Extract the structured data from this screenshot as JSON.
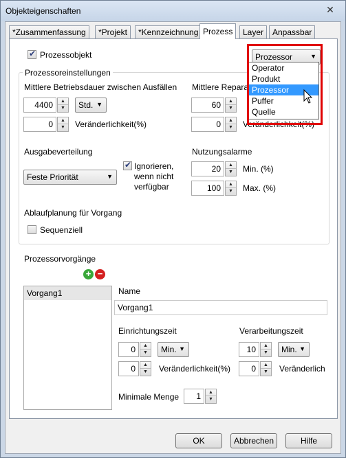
{
  "window": {
    "title": "Objekteigenschaften"
  },
  "icons": {
    "close": "✕",
    "chevron": "▼",
    "up": "▲",
    "down": "▼",
    "add": "+",
    "remove": "−"
  },
  "colors": {
    "add_icon": "#3aa83a",
    "remove_icon": "#d42020",
    "highlight": "#e00000",
    "selection": "#3399ff"
  },
  "tabs": [
    {
      "label": "*Zusammenfassung"
    },
    {
      "label": "*Projekt"
    },
    {
      "label": "*Kennzeichnung"
    },
    {
      "label": "Prozess"
    },
    {
      "label": "Layer"
    },
    {
      "label": "Anpassbar"
    }
  ],
  "prozess": {
    "process_object_label": "Prozessobjekt",
    "process_object_checked": true,
    "type_combo": {
      "value": "Prozessor",
      "options": [
        "Operator",
        "Produkt",
        "Prozessor",
        "Puffer",
        "Quelle"
      ],
      "selected_index": 2
    },
    "processor_settings": {
      "legend": "Prozessoreinstellungen",
      "mtbf_label": "Mittlere Betriebsdauer zwischen Ausfällen",
      "mtbf_value": "4400",
      "mtbf_unit": "Std.",
      "mtbf_variability_value": "0",
      "variability_label": "Veränderlichkeit(%)",
      "mttr_label": "Mittlere Reparat",
      "mttr_value": "60",
      "mttr_variability_value": "0",
      "mttr_variability_label": "Veränderlichkeit(%)",
      "output_distribution_label": "Ausgabeverteilung",
      "output_distribution_value": "Feste Priorität",
      "ignore_label": "Ignorieren, wenn nicht verfügbar",
      "ignore_checked": true,
      "usage_alarms_label": "Nutzungsalarme",
      "min_value": "20",
      "min_label": "Min. (%)",
      "max_value": "100",
      "max_label": "Max. (%)",
      "scheduling_label": "Ablaufplanung für Vorgang",
      "sequential_label": "Sequenziell",
      "sequential_checked": false
    },
    "operations": {
      "label": "Prozessorvorgänge",
      "items": [
        "Vorgang1"
      ],
      "name_label": "Name",
      "name_value": "Vorgang1",
      "setup_time_label": "Einrichtungszeit",
      "setup_time_value": "0",
      "setup_time_unit": "Min.",
      "setup_variability_value": "0",
      "setup_variability_label": "Veränderlichkeit(%)",
      "processing_time_label": "Verarbeitungszeit",
      "processing_time_value": "10",
      "processing_time_unit": "Min.",
      "processing_variability_value": "0",
      "processing_variability_label": "Veränderlich",
      "min_quantity_label": "Minimale Menge",
      "min_quantity_value": "1"
    }
  },
  "buttons": {
    "ok": "OK",
    "cancel": "Abbrechen",
    "help": "Hilfe"
  }
}
